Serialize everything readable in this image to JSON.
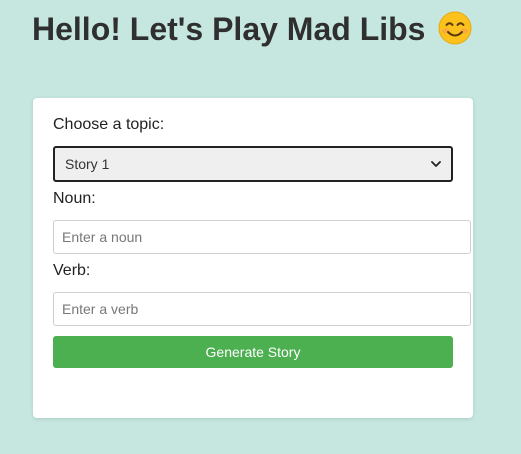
{
  "header": {
    "title": "Hello! Let's Play Mad Libs",
    "emoji_icon": "smiling-face-icon"
  },
  "form": {
    "topic_label": "Choose a topic:",
    "topic_selected": "Story 1",
    "noun_label": "Noun:",
    "noun_placeholder": "Enter a noun",
    "noun_value": "",
    "verb_label": "Verb:",
    "verb_placeholder": "Enter a verb",
    "verb_value": "",
    "generate_label": "Generate Story"
  },
  "colors": {
    "background": "#c6e7e0",
    "card": "#ffffff",
    "button": "#4caf50",
    "button_text": "#ffffff",
    "title": "#2f2f2f"
  }
}
